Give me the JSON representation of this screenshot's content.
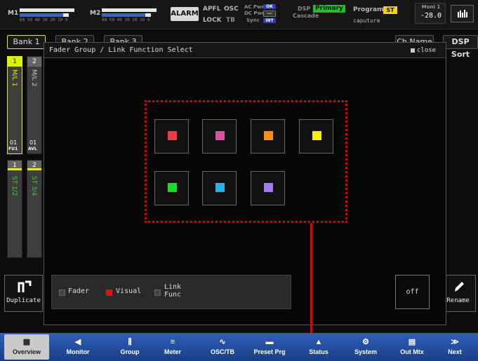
{
  "topbar": {
    "m1_label": "M1",
    "m2_label": "M2",
    "meter_scale": "60 50 40 30 20 10 0",
    "alarm_label": "ALARM",
    "apfl": "APFL",
    "osc": "OSC",
    "lock": "LOCK",
    "tb": "TB",
    "ac_pwr": "AC Pwr",
    "ac_pwr_state": "OK",
    "dc_pwr": "DC Pwr",
    "dc_pwr_state": "---",
    "sync": "Sync",
    "sync_state": "INT",
    "dsp": "DSP",
    "cascade": "Cascade",
    "dsp_primary": "Primary",
    "program": "Program",
    "program_badge": "ST",
    "program_name": "caputure",
    "moni_label": "Moni 1",
    "moni_value": "-28.0",
    "colors": {
      "accent": "#2e3db7",
      "primary": "#21bf2c",
      "st": "#f1d20c"
    }
  },
  "background": {
    "bank1": "Bank 1",
    "bank2": "Bank 2",
    "bank3": "Bank 3",
    "ch_name": "Ch Name",
    "dsp_sort": "DSP Sort",
    "strips": [
      {
        "num": "1",
        "label": "M/L 1",
        "sub": "01",
        "tag": "FU1"
      },
      {
        "num": "2",
        "label": "M/L 2",
        "sub": "01",
        "tag": "AVL"
      },
      {
        "num": "1",
        "label": "ST 1/2"
      },
      {
        "num": "2",
        "label": "ST 3/4"
      }
    ],
    "duplicate": "Duplicate",
    "rename": "Rename"
  },
  "dialog": {
    "title": "Fader Group / Link Function Select",
    "close": "close",
    "groups": [
      {
        "color": "#f03b47"
      },
      {
        "color": "#dc4fa0"
      },
      {
        "color": "#ff8a16"
      },
      {
        "color": "#f4f000"
      },
      {
        "color": "#12e023"
      },
      {
        "color": "#1eb6e6"
      },
      {
        "color": "#a57cf0"
      }
    ],
    "legend": {
      "fader": "Fader",
      "visual": "Visual",
      "link_line1": "Link",
      "link_line2": "Func"
    },
    "off": "off"
  },
  "nav": [
    {
      "label": "Overview",
      "icon": "overview-icon"
    },
    {
      "label": "Monitor",
      "icon": "speaker-icon"
    },
    {
      "label": "Group",
      "icon": "group-icon"
    },
    {
      "label": "Meter",
      "icon": "meter-icon"
    },
    {
      "label": "OSC/TB",
      "icon": "osc-icon"
    },
    {
      "label": "Preset Prg",
      "icon": "preset-icon"
    },
    {
      "label": "Status",
      "icon": "warning-icon"
    },
    {
      "label": "System",
      "icon": "gear-icon"
    },
    {
      "label": "Out Mtx",
      "icon": "matrix-icon"
    },
    {
      "label": "Next",
      "icon": "next-icon"
    }
  ]
}
